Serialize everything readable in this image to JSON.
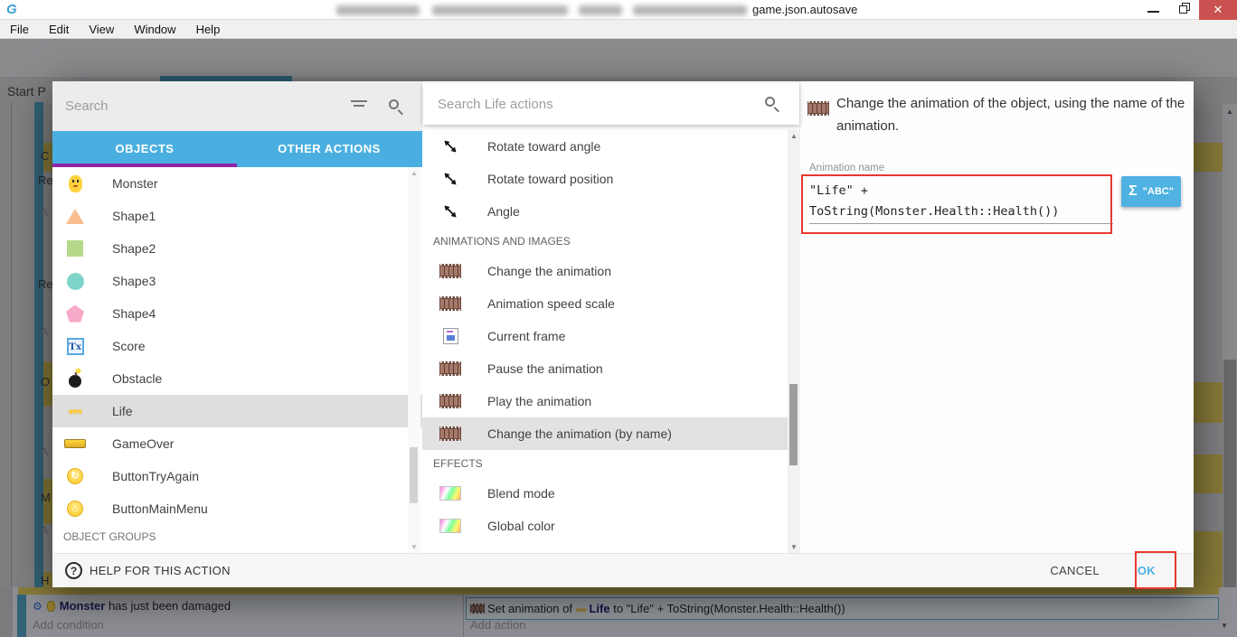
{
  "window": {
    "title_tail": "game.json.autosave",
    "close_glyph": "✕"
  },
  "menu": {
    "items": [
      "File",
      "Edit",
      "View",
      "Window",
      "Help"
    ]
  },
  "background": {
    "tab_label": "Start P",
    "fragments": [
      "C",
      "Re",
      "A",
      "Re",
      "A",
      "O",
      "A",
      "M",
      "A",
      "H"
    ],
    "bottom": {
      "condition_object": "Monster",
      "condition_text": " has just been damaged",
      "add_condition": "Add condition",
      "action_prefix": "Set animation of",
      "action_object": "Life",
      "action_mid": "to",
      "action_value": "\"Life\" + ToString(Monster.Health::Health())",
      "add_action": "Add action"
    }
  },
  "dialog": {
    "left": {
      "search_placeholder": "Search",
      "tabs": [
        {
          "label": "OBJECTS"
        },
        {
          "label": "OTHER ACTIONS"
        }
      ],
      "objects": [
        {
          "label": "Monster"
        },
        {
          "label": "Shape1"
        },
        {
          "label": "Shape2"
        },
        {
          "label": "Shape3"
        },
        {
          "label": "Shape4"
        },
        {
          "label": "Score"
        },
        {
          "label": "Obstacle"
        },
        {
          "label": "Life"
        },
        {
          "label": "GameOver"
        },
        {
          "label": "ButtonTryAgain"
        },
        {
          "label": "ButtonMainMenu"
        }
      ],
      "group_header": "OBJECT GROUPS"
    },
    "middle": {
      "search_placeholder": "Search Life actions",
      "items": [
        {
          "label": "Rotate toward angle"
        },
        {
          "label": "Rotate toward position"
        },
        {
          "label": "Angle"
        },
        {
          "header": "ANIMATIONS AND IMAGES"
        },
        {
          "label": "Change the animation"
        },
        {
          "label": "Animation speed scale"
        },
        {
          "label": "Current frame"
        },
        {
          "label": "Pause the animation"
        },
        {
          "label": "Play the animation"
        },
        {
          "label": "Change the animation (by name)"
        },
        {
          "header": "EFFECTS"
        },
        {
          "label": "Blend mode"
        },
        {
          "label": "Global color"
        }
      ]
    },
    "right": {
      "description": "Change the animation of the object, using the name of the animation.",
      "field_label": "Animation name",
      "field_value_line1": "\"Life\" +",
      "field_value_line2": "ToString(Monster.Health::Health())",
      "sigma": "Σ",
      "expr_button": "\"ABC\""
    },
    "footer": {
      "help": "HELP FOR THIS ACTION",
      "cancel": "CANCEL",
      "ok": "OK"
    }
  },
  "colors": {
    "accent_blue": "#4fb2e2",
    "tab_underline": "#8e24aa",
    "annotation_red": "#e8392f",
    "close_red": "#cb5151"
  }
}
